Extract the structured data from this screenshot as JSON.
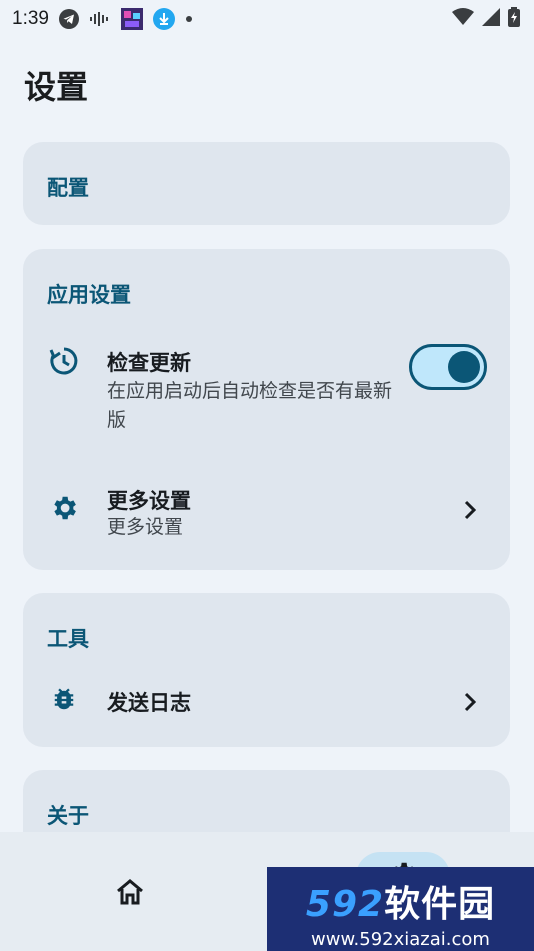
{
  "status_bar": {
    "time": "1:39",
    "icons": [
      "telegram-icon",
      "audio-wave-icon",
      "app-thumbnail-icon",
      "download-icon",
      "dot-icon"
    ],
    "right_icons": [
      "wifi-icon",
      "signal-icon",
      "battery-charging-icon"
    ]
  },
  "page": {
    "title": "设置"
  },
  "sections": {
    "config": {
      "title": "配置"
    },
    "app_settings": {
      "title": "应用设置",
      "check_update": {
        "title": "检查更新",
        "subtitle": "在应用启动后自动检查是否有最新版",
        "enabled": true,
        "icon": "update-history-icon"
      },
      "more_settings": {
        "title": "更多设置",
        "subtitle": "更多设置",
        "icon": "gear-icon"
      }
    },
    "tools": {
      "title": "工具",
      "send_log": {
        "title": "发送日志",
        "icon": "bug-icon"
      }
    },
    "about": {
      "title": "关于"
    }
  },
  "bottom_nav": {
    "items": [
      {
        "icon": "home-icon",
        "selected": false
      },
      {
        "icon": "gear-icon",
        "selected": true
      }
    ]
  },
  "watermark": {
    "logo_num": "592",
    "logo_text": "软件园",
    "url": "www.592xiazai.com"
  },
  "colors": {
    "background": "#eef3f9",
    "card": "#dfe6ee",
    "accent": "#0b5676",
    "toggle_track": "#bfe7fb",
    "nav_pill": "#c5e2f3"
  }
}
